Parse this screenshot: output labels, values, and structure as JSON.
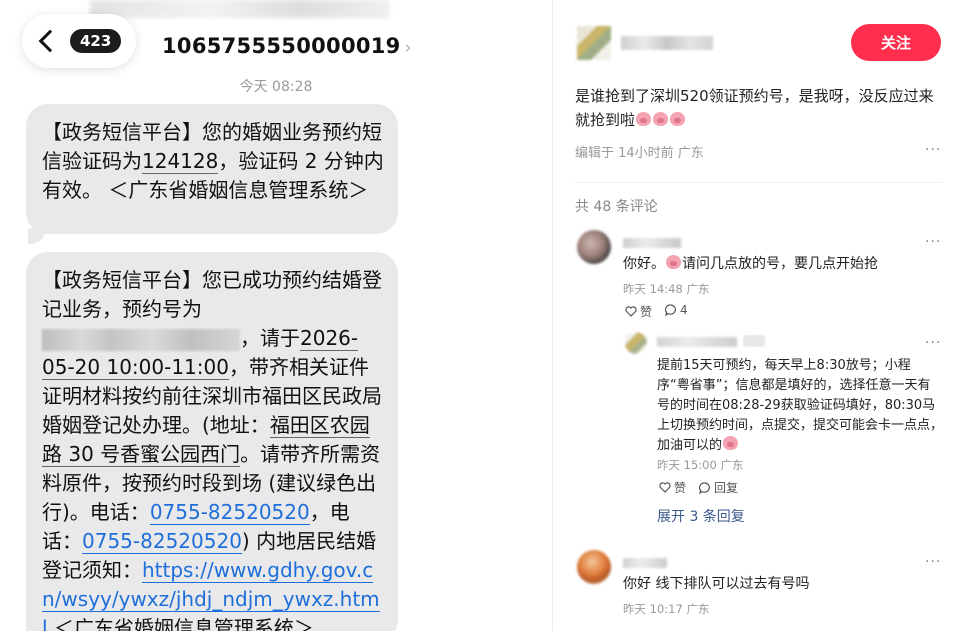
{
  "sms": {
    "badge_count": "423",
    "sender_number": "1065755550000019",
    "sender_chevron": "›",
    "time_label": "今天 08:28",
    "message1": {
      "prefix": "【政务短信平台】您的婚姻业务预约短信验证码为",
      "code": "124128",
      "suffix": "，验证码 2 分钟内有效。 ＜广东省婚姻信息管理系统＞"
    },
    "message2": {
      "line1": "【政务短信平台】您已成功预约结婚登记业务，预约号为",
      "after_redact": "，请于",
      "datetime": "2026-05-20 10:00-11:00",
      "text2": "，带齐相关证件证明材料按约前往深圳市福田区民政局婚姻登记处办理。(地址：",
      "address": "福田区农园路 30 号香蜜公园西门",
      "text3": "。请带齐所需资料原件，按预约时段到场 (建议绿色出行)。电话：",
      "phone1": "0755-82520520",
      "text4": "，电话：",
      "phone2": "0755-82520520",
      "text5": ") 内地居民结婚登记须知：",
      "url": "https://www.gdhy.gov.cn/wsyy/ywxz/jhdj_ndjm_ywxz.html",
      "text6": " ＜广东省婚姻信息管理系统＞"
    }
  },
  "post": {
    "follow_label": "关注",
    "content": "是谁抢到了深圳520领证预约号，是我呀，没反应过来就抢到啦",
    "meta": "编辑于 14小时前 广东",
    "more": "···",
    "comment_count": "共 48 条评论",
    "comments": [
      {
        "text_before": "你好。",
        "text_after": "请问几点放的号，要几点开始抢",
        "meta": "昨天 14:48 广东",
        "like_label": "赞",
        "reply_count": "4",
        "more": "···"
      },
      {
        "text": "你好 线下排队可以过去有号吗",
        "meta": "昨天 10:17 广东",
        "more": "···"
      }
    ],
    "reply": {
      "text": "提前15天可预约，每天早上8:30放号；小程序“粤省事”；信息都是填好的，选择任意一天有号的时间在08:28-29获取验证码填好，80:30马上切换预约时间，点提交，提交可能会卡一点点，加油可以的",
      "meta": "昨天 15:00 广东",
      "like_label": "赞",
      "reply_label": "回复",
      "more": "···"
    },
    "expand_replies": "展开 3 条回复"
  }
}
